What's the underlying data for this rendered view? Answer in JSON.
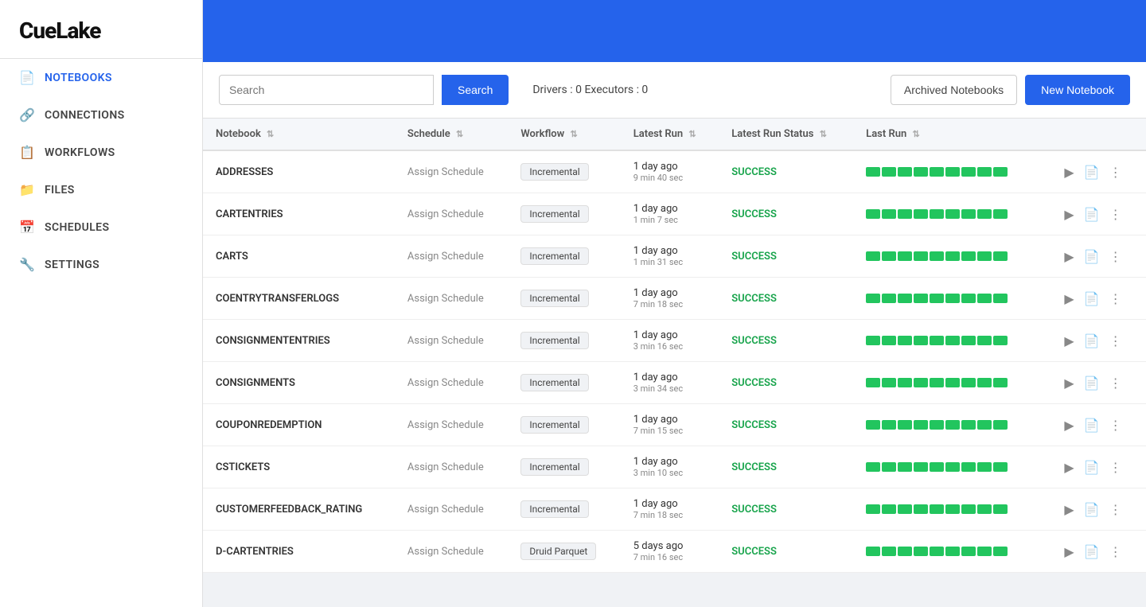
{
  "app": {
    "logo": "CueLake"
  },
  "sidebar": {
    "items": [
      {
        "id": "notebooks",
        "label": "NOTEBOOKS",
        "icon": "📄",
        "active": true
      },
      {
        "id": "connections",
        "label": "CONNECTIONS",
        "icon": "🔗",
        "active": false
      },
      {
        "id": "workflows",
        "label": "WORKFLOWS",
        "icon": "📋",
        "active": false
      },
      {
        "id": "files",
        "label": "FILES",
        "icon": "📁",
        "active": false
      },
      {
        "id": "schedules",
        "label": "SCHEDULES",
        "icon": "📅",
        "active": false
      },
      {
        "id": "settings",
        "label": "SETTINGS",
        "icon": "🔧",
        "active": false
      }
    ]
  },
  "toolbar": {
    "search_placeholder": "Search",
    "search_button_label": "Search",
    "drivers_info": "Drivers : 0   Executors : 0",
    "archived_label": "Archived Notebooks",
    "new_notebook_label": "New Notebook"
  },
  "table": {
    "columns": [
      {
        "id": "notebook",
        "label": "Notebook"
      },
      {
        "id": "schedule",
        "label": "Schedule"
      },
      {
        "id": "workflow",
        "label": "Workflow"
      },
      {
        "id": "latest_run",
        "label": "Latest Run"
      },
      {
        "id": "latest_run_status",
        "label": "Latest Run Status"
      },
      {
        "id": "last_run",
        "label": "Last Run"
      }
    ],
    "rows": [
      {
        "name": "ADDRESSES",
        "schedule": "Assign Schedule",
        "workflow": "Incremental",
        "run_time": "1 day ago",
        "run_duration": "9 min 40 sec",
        "status": "SUCCESS",
        "bars": [
          18,
          3,
          18,
          3,
          18,
          3,
          18,
          3,
          18,
          3,
          18,
          3,
          18,
          3,
          18,
          3,
          18
        ]
      },
      {
        "name": "CARTENTRIES",
        "schedule": "Assign Schedule",
        "workflow": "Incremental",
        "run_time": "1 day ago",
        "run_duration": "1 min 7 sec",
        "status": "SUCCESS",
        "bars": [
          18,
          3,
          18,
          3,
          18,
          3,
          18,
          3,
          18,
          3,
          18,
          3,
          18,
          3,
          18,
          3,
          18
        ]
      },
      {
        "name": "CARTS",
        "schedule": "Assign Schedule",
        "workflow": "Incremental",
        "run_time": "1 day ago",
        "run_duration": "1 min 31 sec",
        "status": "SUCCESS",
        "bars": [
          18,
          3,
          18,
          3,
          18,
          3,
          18,
          3,
          18,
          3,
          18,
          3,
          18,
          3,
          18,
          3,
          18
        ]
      },
      {
        "name": "COENTRYTRANSFERLOGS",
        "schedule": "Assign Schedule",
        "workflow": "Incremental",
        "run_time": "1 day ago",
        "run_duration": "7 min 18 sec",
        "status": "SUCCESS",
        "bars": [
          18,
          3,
          18,
          3,
          18,
          3,
          18,
          3,
          18,
          3,
          18,
          3,
          18,
          3,
          18,
          3,
          18
        ]
      },
      {
        "name": "CONSIGNMENTENTRIES",
        "schedule": "Assign Schedule",
        "workflow": "Incremental",
        "run_time": "1 day ago",
        "run_duration": "3 min 16 sec",
        "status": "SUCCESS",
        "bars": [
          18,
          3,
          18,
          3,
          18,
          3,
          18,
          3,
          18,
          3,
          18,
          3,
          18,
          3,
          18,
          3,
          18
        ]
      },
      {
        "name": "CONSIGNMENTS",
        "schedule": "Assign Schedule",
        "workflow": "Incremental",
        "run_time": "1 day ago",
        "run_duration": "3 min 34 sec",
        "status": "SUCCESS",
        "bars": [
          18,
          3,
          18,
          3,
          18,
          3,
          18,
          3,
          18,
          3,
          18,
          3,
          18,
          3,
          18,
          3,
          18
        ]
      },
      {
        "name": "COUPONREDEMPTION",
        "schedule": "Assign Schedule",
        "workflow": "Incremental",
        "run_time": "1 day ago",
        "run_duration": "7 min 15 sec",
        "status": "SUCCESS",
        "bars": [
          18,
          3,
          18,
          3,
          18,
          3,
          18,
          3,
          18,
          3,
          18,
          3,
          18,
          3,
          18,
          3,
          18
        ]
      },
      {
        "name": "CSTICKETS",
        "schedule": "Assign Schedule",
        "workflow": "Incremental",
        "run_time": "1 day ago",
        "run_duration": "3 min 10 sec",
        "status": "SUCCESS",
        "bars": [
          18,
          3,
          18,
          3,
          18,
          3,
          18,
          3,
          18,
          3,
          18,
          3,
          18,
          3,
          18,
          3,
          18
        ]
      },
      {
        "name": "CUSTOMERFEEDBACK_RATING",
        "schedule": "Assign Schedule",
        "workflow": "Incremental",
        "run_time": "1 day ago",
        "run_duration": "7 min 18 sec",
        "status": "SUCCESS",
        "bars": [
          18,
          3,
          18,
          3,
          18,
          3,
          18,
          3,
          18,
          3,
          18,
          3,
          18,
          3,
          18,
          3,
          18
        ]
      },
      {
        "name": "D-CARTENTRIES",
        "schedule": "Assign Schedule",
        "workflow": "Druid Parquet",
        "run_time": "5 days ago",
        "run_duration": "7 min 16 sec",
        "status": "SUCCESS",
        "bars": [
          18,
          3,
          18,
          3,
          18,
          3,
          18,
          3,
          18,
          3,
          18,
          3,
          18,
          3,
          18,
          3,
          18
        ]
      }
    ]
  },
  "colors": {
    "accent": "#2563eb",
    "success": "#16a34a",
    "bar_green": "#22c55e",
    "bar_gap": "#d1fae5"
  }
}
